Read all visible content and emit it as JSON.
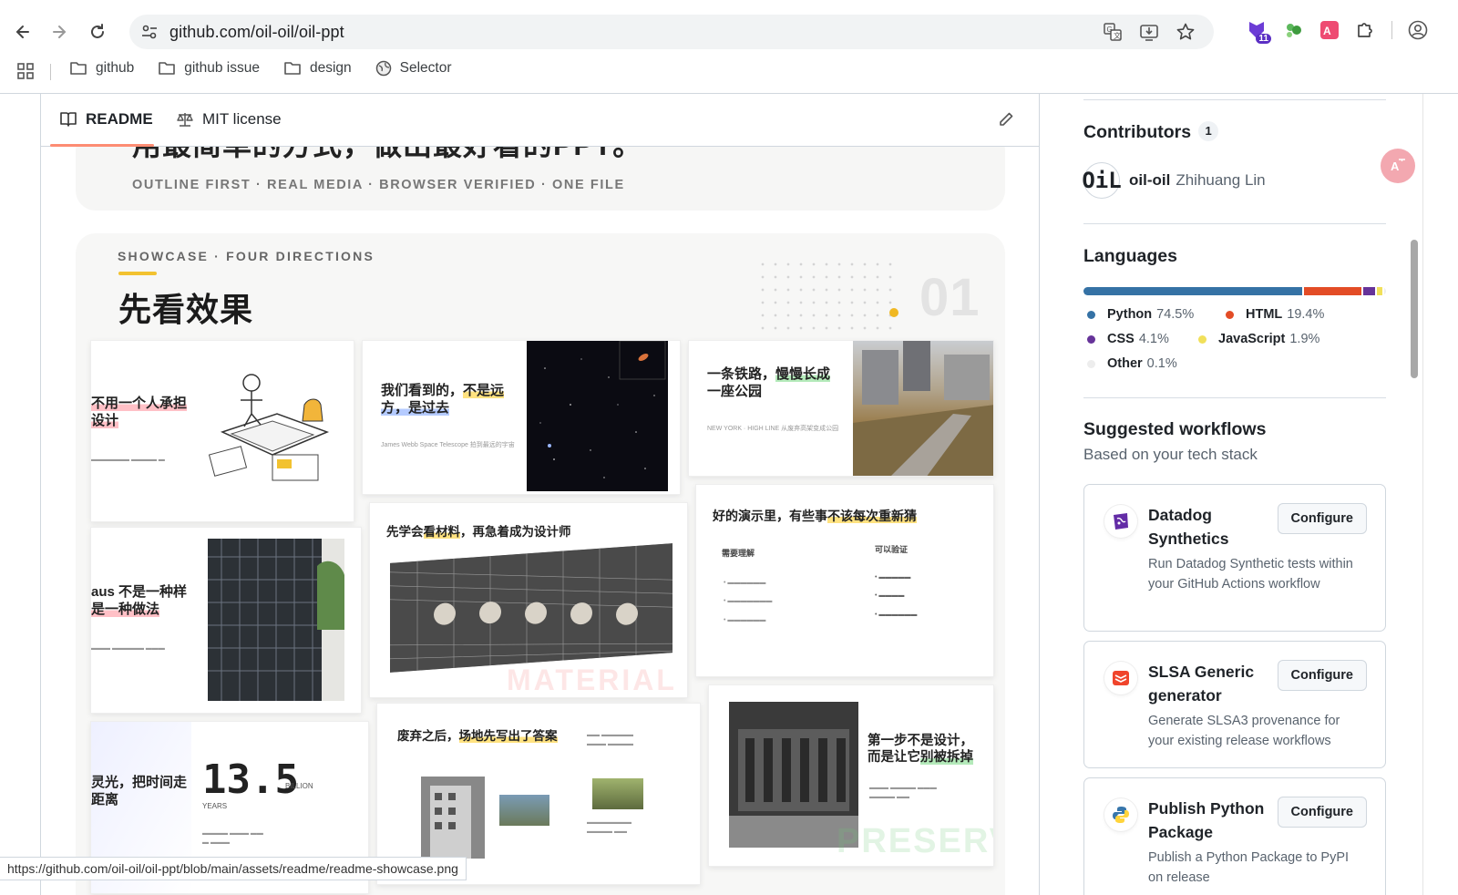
{
  "browser": {
    "url": "github.com/oil-oil/oil-ppt",
    "extension_badge": "11",
    "bookmarks": [
      {
        "label": "github"
      },
      {
        "label": "github issue"
      },
      {
        "label": "design"
      },
      {
        "label": "Selector"
      }
    ],
    "status_url": "https://github.com/oil-oil/oil-ppt/blob/main/assets/readme/readme-showcase.png"
  },
  "readme": {
    "tabs": {
      "readme": "README",
      "license": "MIT license"
    },
    "hero_title_fragment": "用最简单的方式，做出最好看的PPT。",
    "tagline": "OUTLINE FIRST · REAL MEDIA · BROWSER VERIFIED · ONE FILE",
    "showcase": {
      "kicker": "SHOWCASE · FOUR DIRECTIONS",
      "title": "先看效果",
      "number": "01",
      "slides": {
        "s1": "不用一个人承担\n设计",
        "s2a": "我们看到的，",
        "s2b": "不是远",
        "s2c": "方，是过去",
        "s2_caption": "James Webb Space Telescope 拍到最远的宇宙",
        "s3a": "一条铁路，",
        "s3b": "慢慢长成",
        "s3c": "一座公园",
        "s3_caption": "NEW YORK · HIGH LINE 从废弃高架变成公园",
        "s4a": "aus 不是一种样",
        "s4b": "是一种做法",
        "s5a": "先学会",
        "s5b": "看材料",
        "s5c": "，再急着成为设计师",
        "s5_watermark": "MATERIAL",
        "s6a": "好的演示里，有些事",
        "s6b": "不该每次重新猜",
        "s6_col1": "需要理解",
        "s6_col2": "可以验证",
        "s7a": "灵光，把时间走",
        "s7b": "距离",
        "s7_number": "13.5",
        "s7_unit": "BILLION",
        "s7_sub": "YEARS",
        "s8a": "废弃之后，",
        "s8b": "场地先写出了答案",
        "s9a": "第一步不是设计，",
        "s9b": "而是让它",
        "s9c": "别被拆掉",
        "s9_watermark": "PRESERV"
      }
    }
  },
  "sidebar": {
    "contributors": {
      "title": "Contributors",
      "count": "1",
      "user": "oil-oil",
      "name": "Zhihuang Lin",
      "avatar_text": "OiL"
    },
    "languages": {
      "title": "Languages",
      "items": [
        {
          "name": "Python",
          "pct": "74.5%",
          "value": 74.5,
          "color": "#3572A5"
        },
        {
          "name": "HTML",
          "pct": "19.4%",
          "value": 19.4,
          "color": "#e34c26"
        },
        {
          "name": "CSS",
          "pct": "4.1%",
          "value": 4.1,
          "color": "#663399"
        },
        {
          "name": "JavaScript",
          "pct": "1.9%",
          "value": 1.9,
          "color": "#f1e05a"
        },
        {
          "name": "Other",
          "pct": "0.1%",
          "value": 0.1,
          "color": "#ededed"
        }
      ]
    },
    "workflows": {
      "title": "Suggested workflows",
      "subtitle": "Based on your tech stack",
      "items": [
        {
          "title": "Datadog Synthetics",
          "desc": "Run Datadog Synthetic tests within your GitHub Actions workflow",
          "button": "Configure"
        },
        {
          "title": "SLSA Generic generator",
          "desc": "Generate SLSA3 provenance for your existing release workflows",
          "button": "Configure"
        },
        {
          "title": "Publish Python Package",
          "desc": "Publish a Python Package to PyPI on release",
          "button": "Configure"
        }
      ]
    }
  }
}
